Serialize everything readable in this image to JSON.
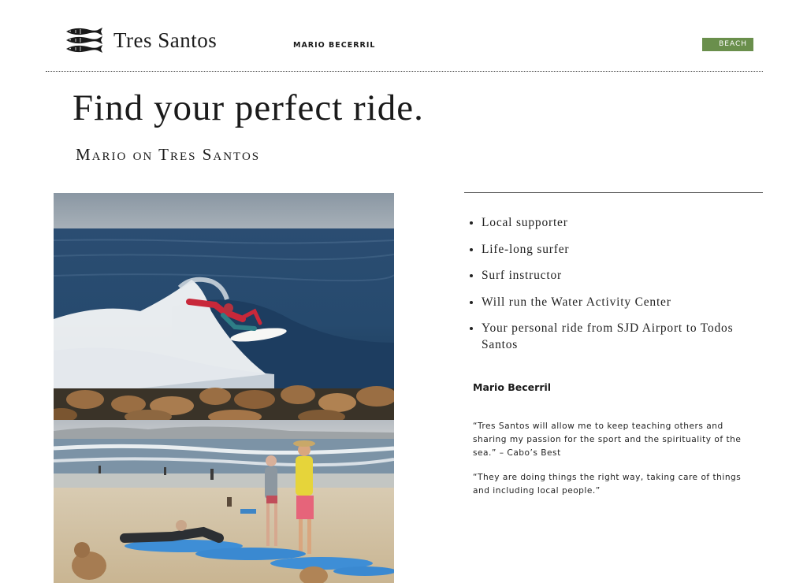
{
  "header": {
    "brand": "Tres Santos",
    "person_link": "MARIO BECERRIL",
    "badge": "BEACH",
    "logo_icon": "three-fish-logo-icon",
    "badge_color": "#6a8f4c"
  },
  "hero": {
    "title": "Find your perfect ride.",
    "subtitle": "Mario on Tres Santos"
  },
  "photos": [
    {
      "name": "surfer-wave-photo"
    },
    {
      "name": "beach-surf-lesson-photo"
    }
  ],
  "profile": {
    "bullets": [
      "Local supporter",
      "Life-long surfer",
      "Surf instructor",
      "Will run the Water Activity Center",
      "Your personal ride from SJD Airport to Todos Santos"
    ],
    "name": "Mario Becerril",
    "quotes": [
      "“Tres Santos will allow me to keep teaching others and sharing my passion for the sport and the spirituality of the sea.” – Cabo’s Best",
      "“They are doing things the right way, taking care of things and including local people.”"
    ]
  }
}
